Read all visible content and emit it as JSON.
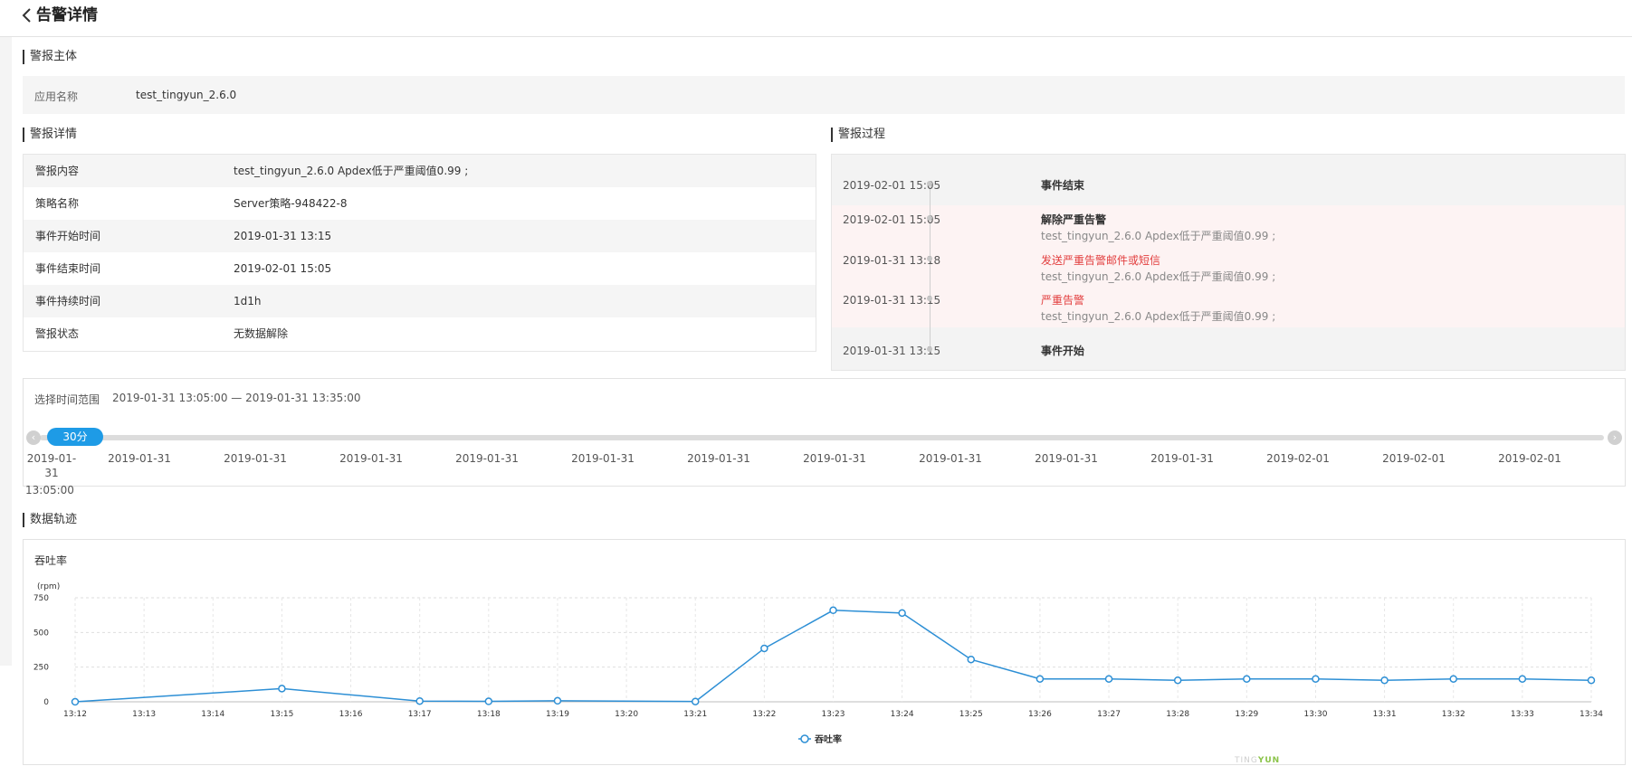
{
  "header": {
    "title": "告警详情"
  },
  "subject": {
    "section_title": "警报主体",
    "app_label": "应用名称",
    "app_value": "test_tingyun_2.6.0"
  },
  "details": {
    "section_title": "警报详情",
    "rows": [
      {
        "label": "警报内容",
        "value": "test_tingyun_2.6.0 Apdex低于严重阈值0.99 ;"
      },
      {
        "label": "策略名称",
        "value": "Server策略-948422-8"
      },
      {
        "label": "事件开始时间",
        "value": "2019-01-31 13:15"
      },
      {
        "label": "事件结束时间",
        "value": "2019-02-01 15:05"
      },
      {
        "label": "事件持续时间",
        "value": "1d1h"
      },
      {
        "label": "警报状态",
        "value": "无数据解除"
      }
    ]
  },
  "process": {
    "section_title": "警报过程",
    "events": [
      {
        "time": "2019-02-01 15:05",
        "title": "事件结束",
        "desc": "",
        "severity": "normal"
      },
      {
        "time": "2019-02-01 15:05",
        "title": "解除严重告警",
        "desc": "test_tingyun_2.6.0 Apdex低于严重阈值0.99 ;",
        "severity": "normal"
      },
      {
        "time": "2019-01-31 13:18",
        "title": "发送严重告警邮件或短信",
        "desc": "test_tingyun_2.6.0 Apdex低于严重阈值0.99 ;",
        "severity": "critical"
      },
      {
        "time": "2019-01-31 13:15",
        "title": "严重告警",
        "desc": "test_tingyun_2.6.0 Apdex低于严重阈值0.99 ;",
        "severity": "critical"
      },
      {
        "time": "2019-01-31 13:15",
        "title": "事件开始",
        "desc": "",
        "severity": "normal"
      }
    ]
  },
  "time_range": {
    "label": "选择时间范围",
    "value": "2019-01-31 13:05:00 — 2019-01-31 13:35:00",
    "handle_label": "30分",
    "prev_arrow": "‹",
    "next_arrow": "›",
    "first_label": [
      "2019-01-",
      "31",
      "13:05:00"
    ],
    "ticks": [
      "2019-01-31",
      "2019-01-31",
      "2019-01-31",
      "2019-01-31",
      "2019-01-31",
      "2019-01-31",
      "2019-01-31",
      "2019-01-31",
      "2019-01-31",
      "2019-01-31",
      "2019-02-01",
      "2019-02-01",
      "2019-02-01"
    ]
  },
  "trajectory": {
    "section_title": "数据轨迹"
  },
  "chart_data": {
    "type": "line",
    "title": "吞吐率",
    "ylabel": "(rpm)",
    "ylim": [
      0,
      750
    ],
    "yticks": [
      0,
      250,
      500,
      750
    ],
    "grid": true,
    "legend_position": "bottom-center",
    "x": [
      "13:12",
      "13:13",
      "13:14",
      "13:15",
      "13:16",
      "13:17",
      "13:18",
      "13:19",
      "13:20",
      "13:21",
      "13:22",
      "13:23",
      "13:24",
      "13:25",
      "13:26",
      "13:27",
      "13:28",
      "13:29",
      "13:30",
      "13:31",
      "13:32",
      "13:33",
      "13:34"
    ],
    "series": [
      {
        "name": "吞吐率",
        "color": "#2d8fd5",
        "values": [
          0,
          null,
          null,
          95,
          null,
          5,
          3,
          7,
          null,
          2,
          385,
          660,
          640,
          305,
          165,
          165,
          155,
          165,
          165,
          155,
          165,
          165,
          155
        ]
      }
    ]
  },
  "watermark": {
    "part1": "TING",
    "part2": "YUN"
  }
}
